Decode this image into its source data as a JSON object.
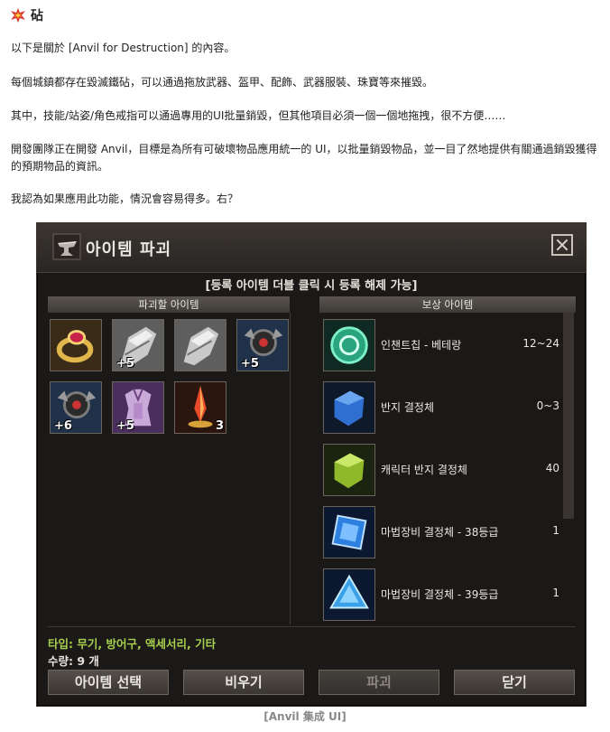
{
  "article": {
    "heading": "砧",
    "paragraphs": [
      "以下是關於 [Anvil for Destruction] 的內容。",
      "每個城鎮都存在毀滅鐵砧，可以通過拖放武器、盔甲、配飾、武器服裝、珠寶等來摧毀。",
      "其中，技能/站姿/角色戒指可以通過專用的UI批量銷毀，但其他項目必須一個一個地拖拽，很不方便……",
      "開發團隊正在開發 Anvil，目標是為所有可破壞物品應用統一的 UI，以批量銷毀物品，並一目了然地提供有關通過銷毀獲得的預期物品的資訊。",
      "我認為如果應用此功能，情況會容易得多。右？"
    ],
    "caption": "[Anvil 集成 UI]"
  },
  "window": {
    "title": "아이템 파괴",
    "notice": "[등록 아이템 더블 클릭 시 등록 해제 가능]",
    "left_header": "파괴할 아이템",
    "right_header": "보상 아이템",
    "items": [
      {
        "icon": "ring-icon",
        "count": ""
      },
      {
        "icon": "gauntlet-icon",
        "count": "+5"
      },
      {
        "icon": "gauntlet-icon",
        "count": ""
      },
      {
        "icon": "dark-amulet-icon",
        "count": "+5"
      },
      {
        "icon": "dark-amulet-icon",
        "count": "+6"
      },
      {
        "icon": "armor-icon",
        "count": "+5"
      },
      {
        "icon": "red-crystal-icon",
        "count": "3"
      }
    ],
    "rewards": [
      {
        "icon": "enchant-chip-icon",
        "name": "인챈트칩 - 베테랑",
        "qty": "12~24"
      },
      {
        "icon": "blue-crystal-icon",
        "name": "반지 결정체",
        "qty": "0~3"
      },
      {
        "icon": "green-crystal-icon",
        "name": "캐릭터 반지 결정체",
        "qty": "40"
      },
      {
        "icon": "sapphire-icon",
        "name": "마법장비 결정체 - 38등급",
        "qty": "1"
      },
      {
        "icon": "diamond-icon",
        "name": "마법장비 결정체 - 39등급",
        "qty": "1"
      }
    ],
    "type_line": "타입: 무기, 방어구, 액세서리, 기타",
    "count_line": "수량: 9 개",
    "buttons": {
      "select": "아이템 선택",
      "empty": "비우기",
      "destroy": "파괴",
      "close": "닫기"
    }
  }
}
